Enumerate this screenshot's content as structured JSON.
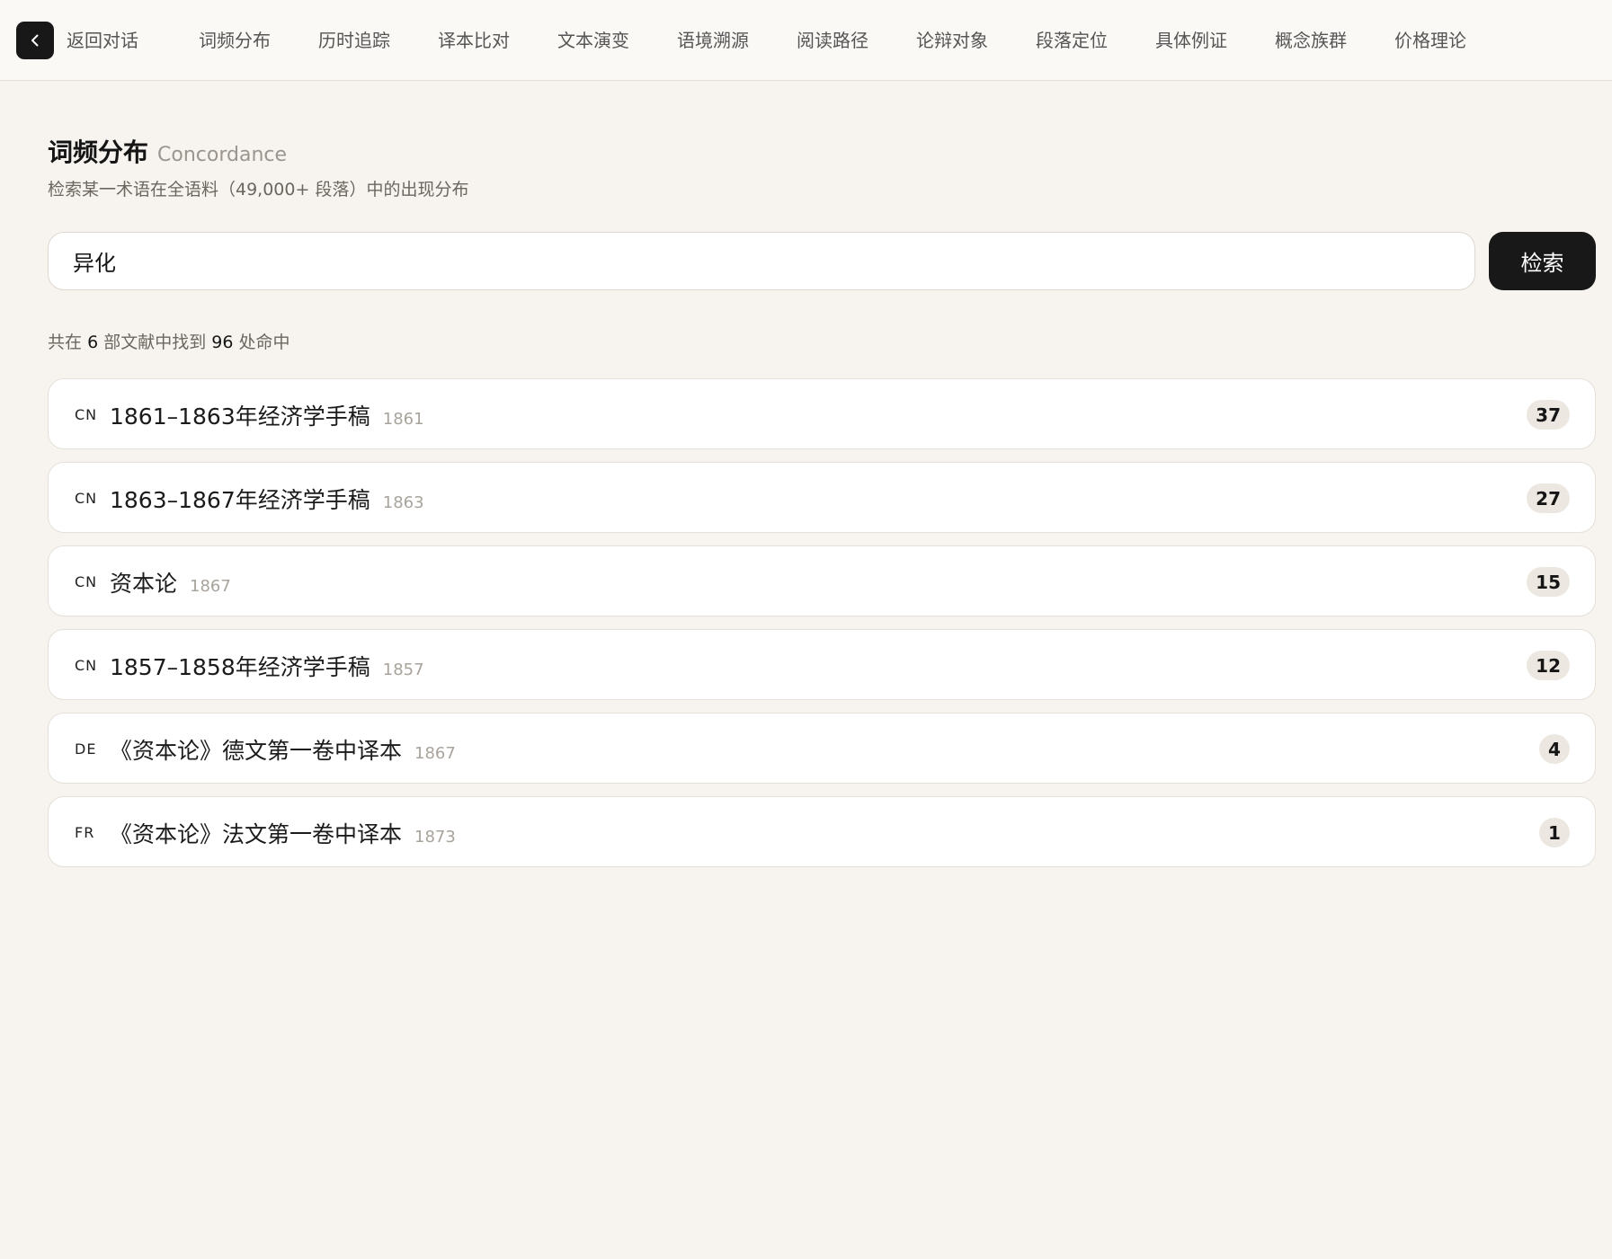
{
  "nav": {
    "back_label": "返回对话",
    "back_icon": "chevron-left-icon",
    "tabs": [
      {
        "label": "词频分布"
      },
      {
        "label": "历时追踪"
      },
      {
        "label": "译本比对"
      },
      {
        "label": "文本演变"
      },
      {
        "label": "语境溯源"
      },
      {
        "label": "阅读路径"
      },
      {
        "label": "论辩对象"
      },
      {
        "label": "段落定位"
      },
      {
        "label": "具体例证"
      },
      {
        "label": "概念族群"
      },
      {
        "label": "价格理论"
      }
    ]
  },
  "header": {
    "title": "词频分布",
    "title_en": "Concordance",
    "subtitle": "检索某一术语在全语料（49,000+ 段落）中的出现分布"
  },
  "search": {
    "value": "异化",
    "button_label": "检索"
  },
  "summary": {
    "prefix": "共在",
    "doc_count": "6",
    "middle": "部文献中找到",
    "hit_count": "96",
    "suffix": "处命中"
  },
  "results": [
    {
      "lang": "CN",
      "title": "1861–1863年经济学手稿",
      "year": "1861",
      "count": "37"
    },
    {
      "lang": "CN",
      "title": "1863–1867年经济学手稿",
      "year": "1863",
      "count": "27"
    },
    {
      "lang": "CN",
      "title": "资本论",
      "year": "1867",
      "count": "15"
    },
    {
      "lang": "CN",
      "title": "1857–1858年经济学手稿",
      "year": "1857",
      "count": "12"
    },
    {
      "lang": "DE",
      "title": "《资本论》德文第一卷中译本",
      "year": "1867",
      "count": "4"
    },
    {
      "lang": "FR",
      "title": "《资本论》法文第一卷中译本",
      "year": "1873",
      "count": "1"
    }
  ],
  "colors": {
    "background": "#f7f4ef",
    "accent_dark": "#181818",
    "badge_bg": "#ece8e1"
  }
}
